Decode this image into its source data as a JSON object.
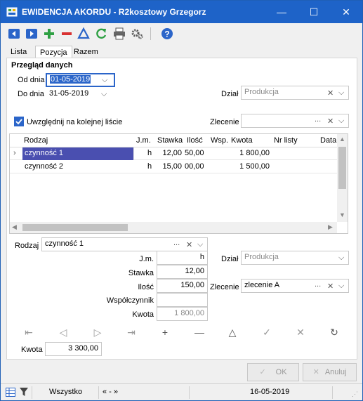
{
  "window": {
    "title": "EWIDENCJA AKORDU - R2kosztowy Grzegorz",
    "accent": "#1e63c8"
  },
  "tabs": [
    "Lista",
    "Pozycja",
    "Razem"
  ],
  "active_tab": 1,
  "section_title": "Przegląd danych",
  "filters": {
    "from_label": "Od dnia",
    "from_value": "01-05-2019",
    "to_label": "Do dnia",
    "to_value": "31-05-2019",
    "dzial_label": "Dział",
    "dzial_value": "Produkcja",
    "checkbox_label": "Uwzględnij na kolejnej liście",
    "checkbox_checked": true,
    "zlecenie_label": "Zlecenie",
    "zlecenie_value": ""
  },
  "grid": {
    "headers": [
      "Rodzaj",
      "J.m.",
      "Stawka",
      "Ilość",
      "Wsp.",
      "Kwota",
      "Nr listy",
      "Data"
    ],
    "rows": [
      {
        "rodzaj": "czynność 1",
        "jm": "h",
        "stawka": "12,00",
        "ilosc": "50,00",
        "wsp": "",
        "kwota": "1 800,00",
        "nr": "",
        "data": "",
        "selected": true
      },
      {
        "rodzaj": "czynność 2",
        "jm": "h",
        "stawka": "15,00",
        "ilosc": "00,00",
        "wsp": "",
        "kwota": "1 500,00",
        "nr": "",
        "data": "",
        "selected": false
      }
    ]
  },
  "detail": {
    "rodzaj_label": "Rodzaj",
    "rodzaj_value": "czynność 1",
    "jm_label": "J.m.",
    "jm_value": "h",
    "stawka_label": "Stawka",
    "stawka_value": "12,00",
    "ilosc_label": "Ilość",
    "ilosc_value": "150,00",
    "wsp_label": "Współczynnik",
    "wsp_value": "",
    "kwota_label": "Kwota",
    "kwota_value": "1 800,00",
    "dzial_label": "Dział",
    "dzial_value": "Produkcja",
    "zlecenie_label": "Zlecenie",
    "zlecenie_value": "zlecenie A"
  },
  "total": {
    "label": "Kwota",
    "value": "3 300,00"
  },
  "buttons": {
    "ok": "OK",
    "cancel": "Anuluj"
  },
  "status": {
    "filter": "Wszystko",
    "nav": "« - »",
    "date": "16-05-2019"
  },
  "symbols": {
    "ellipsis": "...",
    "clear": "✕",
    "chevron": "⌵"
  }
}
